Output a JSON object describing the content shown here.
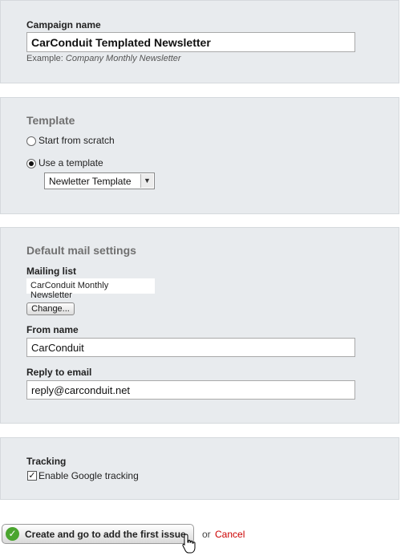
{
  "campaign": {
    "label": "Campaign name",
    "value": "CarConduit Templated Newsletter",
    "hint_prefix": "Example: ",
    "hint_example": "Company Monthly Newsletter"
  },
  "template": {
    "heading": "Template",
    "option_scratch": "Start from scratch",
    "option_template": "Use a template",
    "selected_option": "Use a template",
    "select_value": "Newletter Template"
  },
  "mail": {
    "heading": "Default mail settings",
    "mailing_list_label": "Mailing list",
    "mailing_list_value": "CarConduit Monthly Newsletter",
    "change_label": "Change...",
    "from_name_label": "From name",
    "from_name_value": "CarConduit",
    "reply_label": "Reply to email",
    "reply_value": "reply@carconduit.net"
  },
  "tracking": {
    "label": "Tracking",
    "google_label": "Enable Google tracking",
    "google_checked": true
  },
  "actions": {
    "create_label": "Create and go to add the first issue",
    "or_label": "or",
    "cancel_label": "Cancel",
    "cancel_color": "#cc0000"
  }
}
